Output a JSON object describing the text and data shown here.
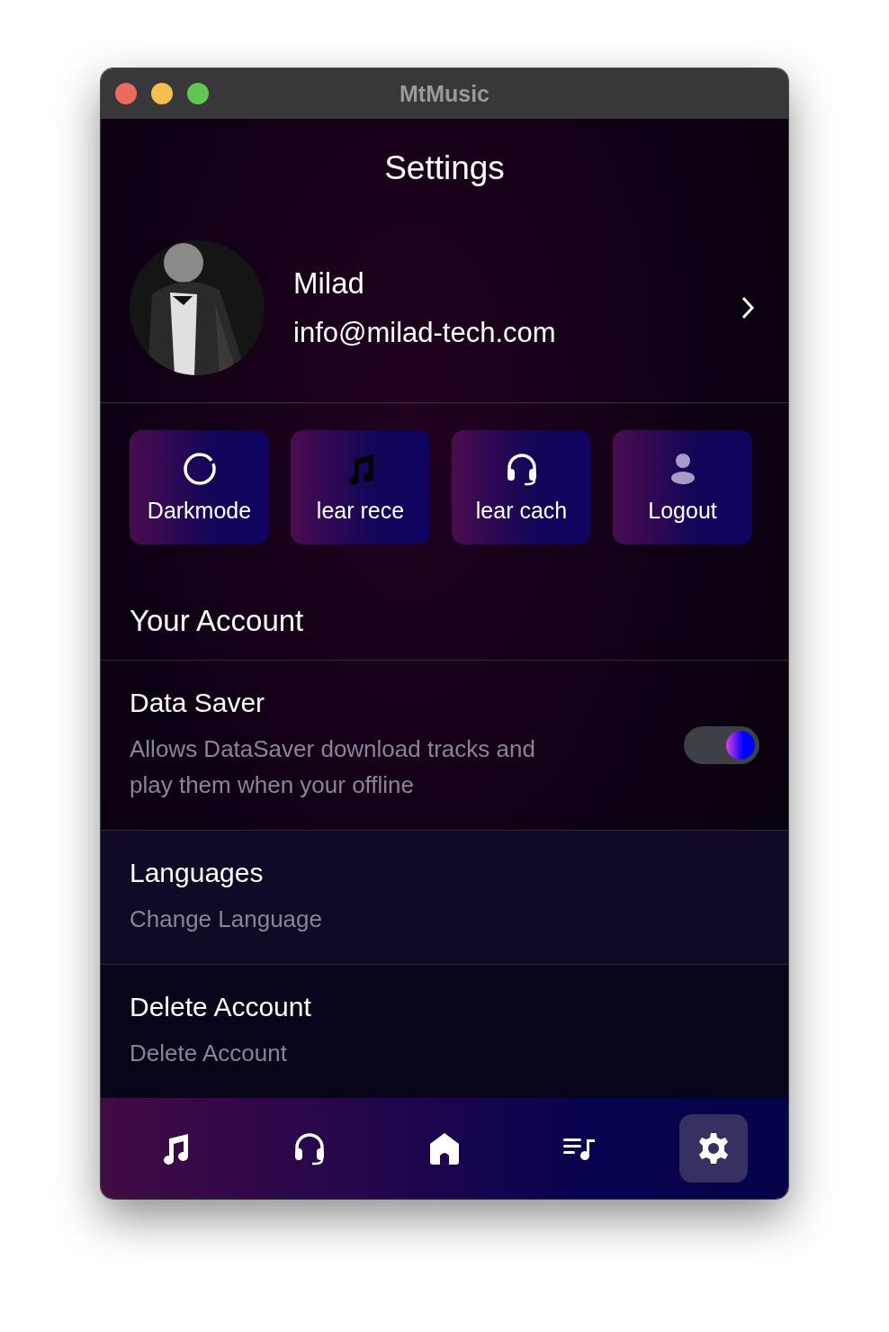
{
  "window": {
    "title": "MtMusic"
  },
  "header": {
    "title": "Settings"
  },
  "profile": {
    "name": "Milad",
    "email": "info@milad-tech.com"
  },
  "quick_actions": [
    {
      "kind": "circle",
      "label": "Darkmode"
    },
    {
      "kind": "music",
      "label": "lear rece"
    },
    {
      "kind": "headphones",
      "label": "lear cach"
    },
    {
      "kind": "person",
      "label": "Logout"
    }
  ],
  "section_title": "Your Account",
  "settings": [
    {
      "kind": "toggle",
      "title": "Data Saver",
      "description": "Allows DataSaver download tracks and play them when your offline",
      "on": true
    },
    {
      "kind": "link",
      "title": "Languages",
      "description": "Change Language"
    },
    {
      "kind": "link",
      "title": "Delete Account",
      "description": "Delete Account"
    }
  ],
  "nav": [
    {
      "kind": "music",
      "selected": false
    },
    {
      "kind": "headphones",
      "selected": false
    },
    {
      "kind": "home",
      "selected": false
    },
    {
      "kind": "playlist",
      "selected": false
    },
    {
      "kind": "settings",
      "selected": true
    }
  ]
}
